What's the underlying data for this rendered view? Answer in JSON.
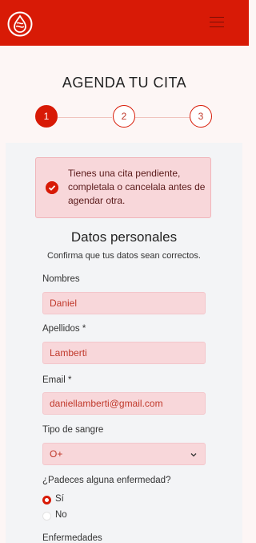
{
  "header": {
    "logo_icon": "blood-drop-logo-icon",
    "menu_icon": "hamburger-menu-icon",
    "brand_color": "#d81a06"
  },
  "page": {
    "title": "AGENDA TU CITA"
  },
  "steps": [
    {
      "label": "1",
      "state": "active"
    },
    {
      "label": "2",
      "state": "pending"
    },
    {
      "label": "3",
      "state": "pending"
    }
  ],
  "alert": {
    "icon": "check-circle-icon",
    "text": "Tienes una cita pendiente, completala o cancelala antes de agendar otra."
  },
  "form": {
    "section_title": "Datos personales",
    "section_subtitle": "Confirma que tus datos sean correctos.",
    "nombres": {
      "label": "Nombres",
      "value": "Daniel"
    },
    "apellidos": {
      "label": "Apellidos *",
      "value": "Lamberti"
    },
    "email": {
      "label": "Email *",
      "value": "daniellamberti@gmail.com"
    },
    "tipo_sangre": {
      "label": "Tipo de sangre",
      "value": "O+",
      "icon": "chevron-down-icon"
    },
    "enfermedad": {
      "question": "¿Padeces alguna enfermedad?",
      "options": [
        {
          "label": "Sí",
          "selected": true
        },
        {
          "label": "No",
          "selected": false
        }
      ]
    },
    "enfermedades": {
      "label": "Enfermedades"
    }
  }
}
